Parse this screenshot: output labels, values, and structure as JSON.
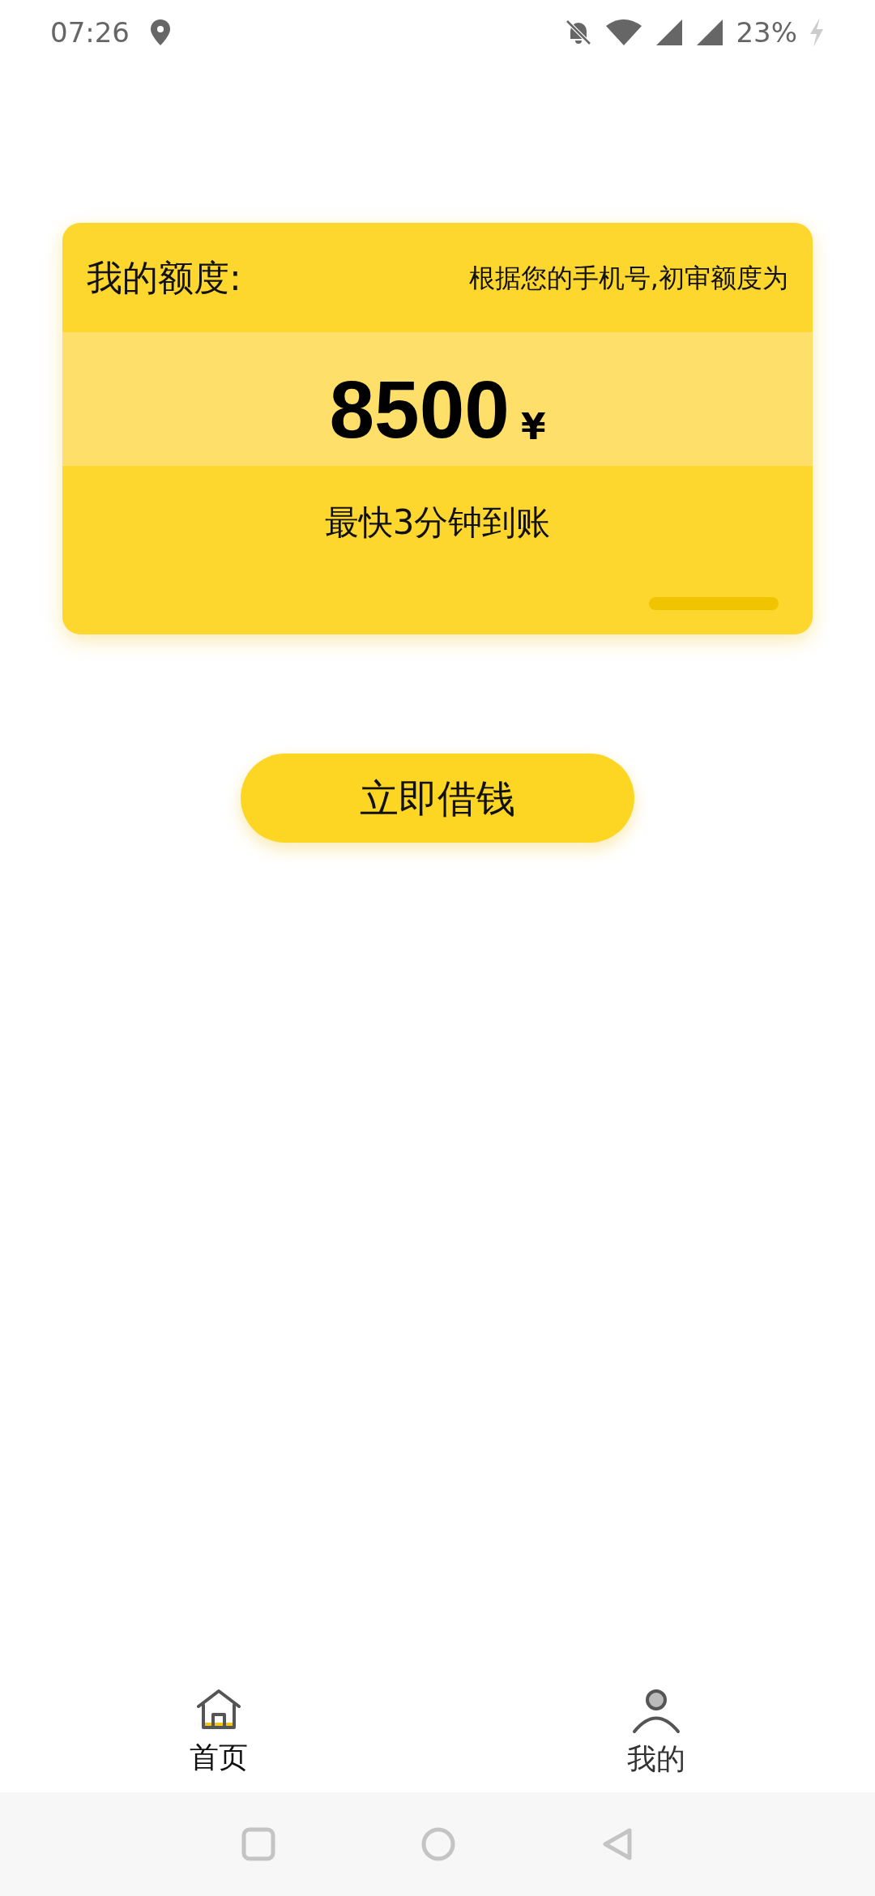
{
  "status_bar": {
    "time": "07:26",
    "battery": "23%"
  },
  "card": {
    "title": "我的额度:",
    "note": "根据您的手机号,初审额度为",
    "amount": "8500",
    "currency": "¥",
    "subtitle": "最快3分钟到账"
  },
  "action_button": "立即借钱",
  "bottom_nav": [
    {
      "kind": "home",
      "label": "首页",
      "selected": true
    },
    {
      "kind": "profile",
      "label": "我的",
      "selected": false
    }
  ]
}
